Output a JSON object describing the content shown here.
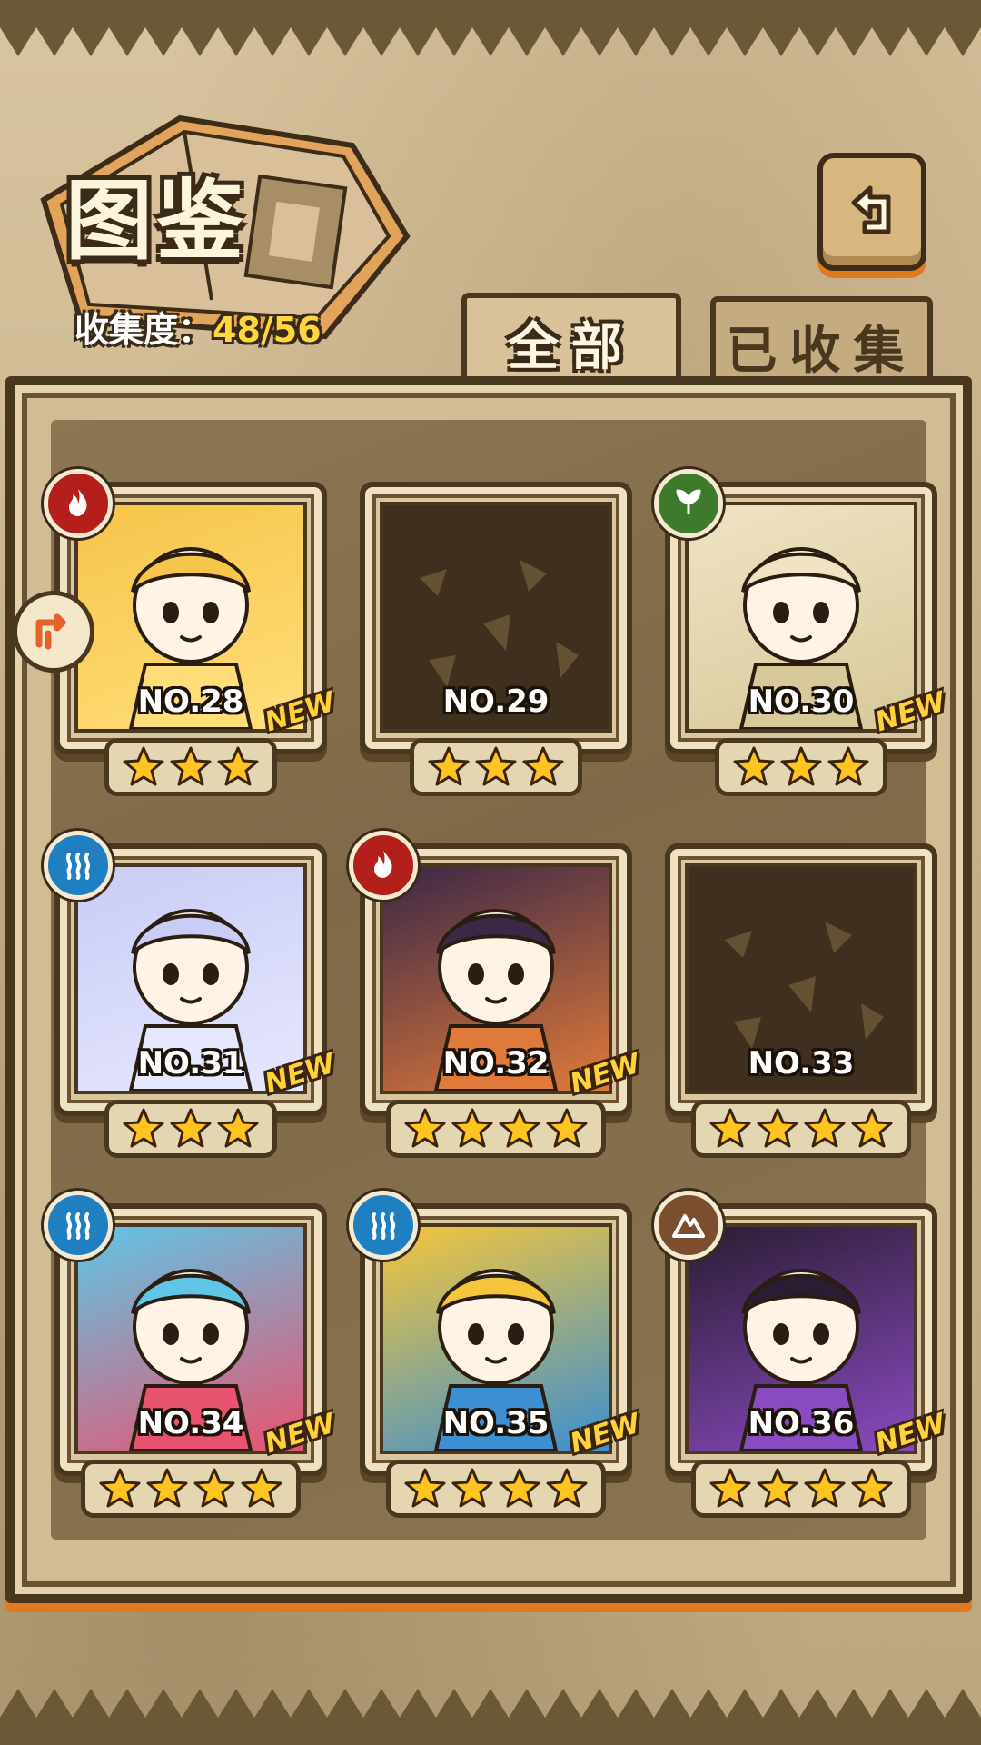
{
  "header": {
    "title": "图鉴",
    "collection_label": "收集度：",
    "collection_value": "48/56"
  },
  "tabs": [
    {
      "label": "全部",
      "active": true
    },
    {
      "label": "已收集",
      "active": false
    }
  ],
  "icons": {
    "back": "back-arrow-icon",
    "sort": "sort-arrow-icon"
  },
  "colors": {
    "fire": "#b3201c",
    "water": "#1f7fc0",
    "nature": "#3e7a2c",
    "earth": "#7a4e2f",
    "star": "#ffc41f",
    "accent": "#ffd640"
  },
  "cards": [
    {
      "no": "NO.28",
      "stars": 3,
      "element": "fire",
      "new": "NEW",
      "locked": false,
      "palette": [
        "#f6c54a",
        "#ffde7a"
      ]
    },
    {
      "no": "NO.29",
      "stars": 3,
      "element": "",
      "new": "",
      "locked": true,
      "palette": [
        "#3f2f1e",
        "#3f2f1e"
      ]
    },
    {
      "no": "NO.30",
      "stars": 3,
      "element": "nature",
      "new": "NEW",
      "locked": false,
      "palette": [
        "#efe3c4",
        "#d8c99a"
      ]
    },
    {
      "no": "NO.31",
      "stars": 3,
      "element": "water",
      "new": "NEW",
      "locked": false,
      "palette": [
        "#c9ccf4",
        "#e6e8ff"
      ]
    },
    {
      "no": "NO.32",
      "stars": 4,
      "element": "fire",
      "new": "NEW",
      "locked": false,
      "palette": [
        "#3b2746",
        "#e07a3a"
      ]
    },
    {
      "no": "NO.33",
      "stars": 4,
      "element": "",
      "new": "",
      "locked": true,
      "palette": [
        "#3f2f1e",
        "#3f2f1e"
      ]
    },
    {
      "no": "NO.34",
      "stars": 4,
      "element": "water",
      "new": "NEW",
      "locked": false,
      "palette": [
        "#5fc6e6",
        "#e8536f"
      ]
    },
    {
      "no": "NO.35",
      "stars": 4,
      "element": "water",
      "new": "NEW",
      "locked": false,
      "palette": [
        "#f5c63a",
        "#3c8fd0"
      ]
    },
    {
      "no": "NO.36",
      "stars": 4,
      "element": "earth",
      "new": "NEW",
      "locked": false,
      "palette": [
        "#2a1d33",
        "#8a4ac0"
      ]
    }
  ]
}
